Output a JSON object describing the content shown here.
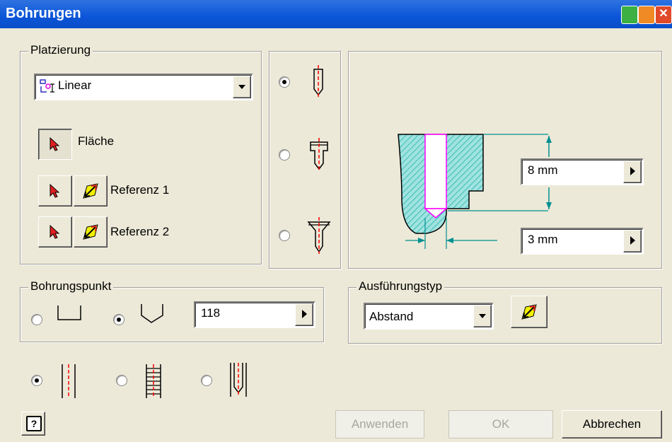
{
  "window": {
    "title": "Bohrungen"
  },
  "placement": {
    "legend": "Platzierung",
    "type_value": "Linear",
    "face_label": "Fläche",
    "ref1_label": "Referenz 1",
    "ref2_label": "Referenz 2"
  },
  "hole_type": {
    "selected_index": 0
  },
  "preview": {
    "depth_value": "8 mm",
    "diameter_value": "3 mm"
  },
  "drill_point": {
    "legend": "Bohrungspunkt",
    "angle_value": "118"
  },
  "termination": {
    "legend": "Ausführungstyp",
    "value": "Abstand"
  },
  "thread": {
    "selected_index": 0
  },
  "buttons": {
    "apply": "Anwenden",
    "ok": "OK",
    "cancel": "Abbrechen",
    "help": "?"
  },
  "colors": {
    "titlebar": "#0a55d8",
    "dialog_bg": "#ece9d8",
    "hatch": "#20b0a8",
    "hole_outline": "#ff00ff",
    "centerline": "#ff0000"
  }
}
